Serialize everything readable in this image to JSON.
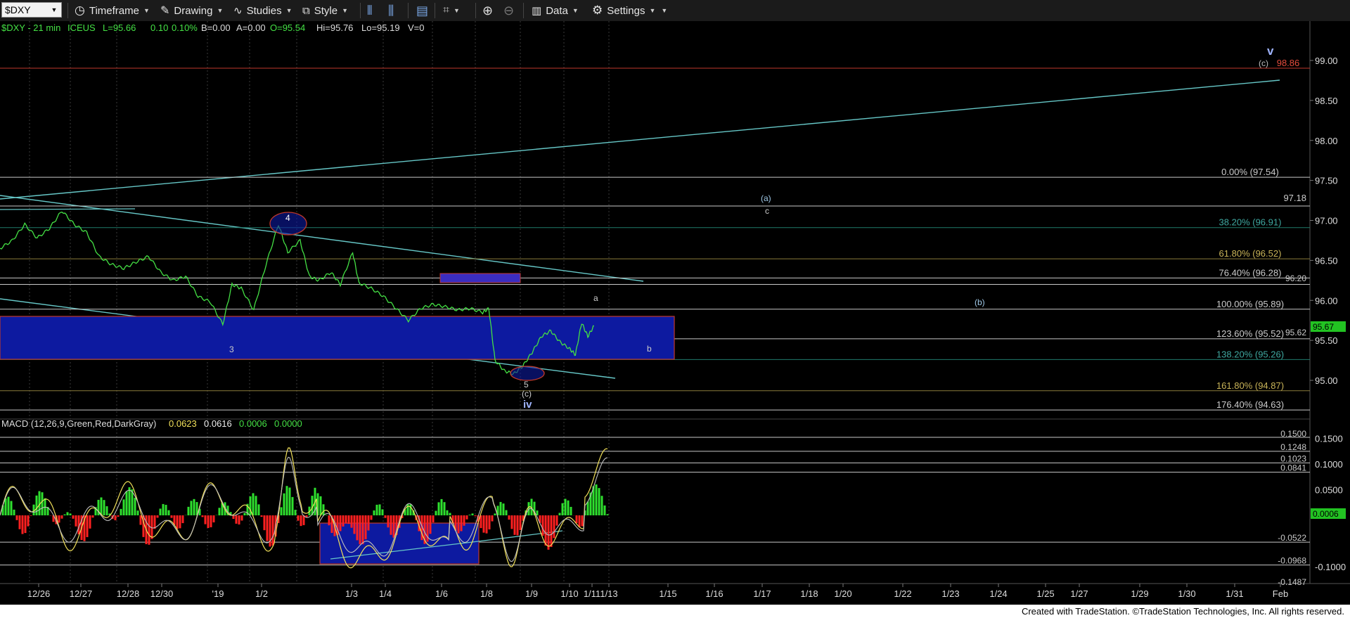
{
  "toolbar": {
    "symbol": "$DXY",
    "timeframe": "Timeframe",
    "drawing": "Drawing",
    "studies": "Studies",
    "style": "Style",
    "data": "Data",
    "settings": "Settings"
  },
  "legend": {
    "symbol": "$DXY - 21 min",
    "exchange": "ICEUS",
    "last": "L=95.66",
    "change": "0.10",
    "pct": "0.10%",
    "bid": "B=0.00",
    "ask": "A=0.00",
    "open": "O=95.54",
    "hi": "Hi=95.76",
    "lo": "Lo=95.19",
    "vol": "V=0"
  },
  "macd_legend": {
    "label": "MACD (12,26,9,Green,Red,DarkGray)",
    "v1": "0.0623",
    "v2": "0.0616",
    "v3": "0.0006",
    "v4": "0.0000"
  },
  "price_axis": [
    "99.00",
    "98.50",
    "98.00",
    "97.50",
    "97.00",
    "96.50",
    "96.00",
    "95.50",
    "95.00"
  ],
  "price_tag": "95.67",
  "red_line_label": "98.86",
  "level_9718": "97.18",
  "level_9620": "96.20",
  "level_9562": "95.62",
  "fib_levels": [
    {
      "label": "0.00% (97.54)",
      "value": 97.54
    },
    {
      "label": "38.20% (96.91)",
      "value": 96.91
    },
    {
      "label": "61.80% (96.52)",
      "value": 96.52
    },
    {
      "label": "76.40% (96.28)",
      "value": 96.28
    },
    {
      "label": "100.00% (95.89)",
      "value": 95.89
    },
    {
      "label": "123.60% (95.52)",
      "value": 95.52
    },
    {
      "label": "138.20% (95.26)",
      "value": 95.26
    },
    {
      "label": "161.80% (94.87)",
      "value": 94.87
    },
    {
      "label": "176.40% (94.63)",
      "value": 94.63
    }
  ],
  "macd_axis": [
    "0.1500",
    "0.1000",
    "0.0500",
    "-0.1000"
  ],
  "macd_levels": [
    "0.1248",
    "0.1023",
    "0.0841",
    "-0.0522",
    "-0.0968"
  ],
  "macd_top_partial": "0.1500",
  "macd_bottom_partial": "-0.1487",
  "macd_tag": "0.0006",
  "wave_labels": {
    "v": "v",
    "c_top": "(c)",
    "a_paren": "(a)",
    "c": "c",
    "b_paren": "(b)",
    "four": "4",
    "three": "3",
    "a": "a",
    "b": "b",
    "five": "5",
    "c_low": "(c)",
    "iv": "iv"
  },
  "dates": [
    "12/26",
    "12/27",
    "12/28",
    "12/30",
    "'19",
    "1/2",
    "1/3",
    "1/4",
    "1/6",
    "1/8",
    "1/9",
    "1/10",
    "1/11",
    "1/13",
    "1/15",
    "1/16",
    "1/17",
    "1/18",
    "1/20",
    "1/22",
    "1/23",
    "1/24",
    "1/25",
    "1/27",
    "1/29",
    "1/30",
    "1/31",
    "Feb"
  ],
  "footer": "Created with TradeStation. ©TradeStation Technologies, Inc. All rights reserved.",
  "chart_data": {
    "type": "line",
    "title": "$DXY - 21 min",
    "ylim": [
      94.45,
      99.55
    ],
    "price_path": [
      [
        0,
        96.65
      ],
      [
        0.4,
        96.75
      ],
      [
        0.8,
        96.95
      ],
      [
        1.2,
        96.78
      ],
      [
        1.6,
        96.9
      ],
      [
        2.0,
        97.12
      ],
      [
        2.4,
        96.95
      ],
      [
        2.8,
        96.85
      ],
      [
        3.2,
        96.55
      ],
      [
        3.6,
        96.45
      ],
      [
        4.0,
        96.4
      ],
      [
        4.4,
        96.48
      ],
      [
        4.8,
        96.55
      ],
      [
        5.2,
        96.35
      ],
      [
        5.6,
        96.25
      ],
      [
        6.0,
        96.3
      ],
      [
        6.4,
        96.05
      ],
      [
        6.8,
        95.98
      ],
      [
        7.2,
        95.7
      ],
      [
        7.5,
        96.2
      ],
      [
        7.8,
        96.15
      ],
      [
        8.2,
        95.88
      ],
      [
        8.6,
        96.45
      ],
      [
        9.0,
        96.95
      ],
      [
        9.3,
        96.6
      ],
      [
        9.7,
        96.75
      ],
      [
        10.0,
        96.3
      ],
      [
        10.3,
        96.25
      ],
      [
        10.7,
        96.35
      ],
      [
        11.0,
        96.2
      ],
      [
        11.4,
        96.6
      ],
      [
        11.6,
        96.22
      ],
      [
        12.0,
        96.15
      ],
      [
        12.4,
        96.05
      ],
      [
        12.8,
        95.9
      ],
      [
        13.2,
        95.75
      ],
      [
        13.6,
        95.9
      ],
      [
        14.0,
        95.95
      ],
      [
        14.4,
        95.92
      ],
      [
        14.8,
        95.88
      ],
      [
        15.2,
        95.9
      ],
      [
        15.6,
        95.85
      ],
      [
        15.8,
        95.9
      ],
      [
        16.0,
        95.25
      ],
      [
        16.3,
        95.12
      ],
      [
        16.6,
        95.08
      ],
      [
        16.9,
        95.18
      ],
      [
        17.2,
        95.35
      ],
      [
        17.5,
        95.55
      ],
      [
        17.8,
        95.62
      ],
      [
        18.1,
        95.48
      ],
      [
        18.4,
        95.4
      ],
      [
        18.6,
        95.32
      ],
      [
        18.8,
        95.72
      ],
      [
        19.0,
        95.55
      ],
      [
        19.2,
        95.68
      ]
    ]
  }
}
